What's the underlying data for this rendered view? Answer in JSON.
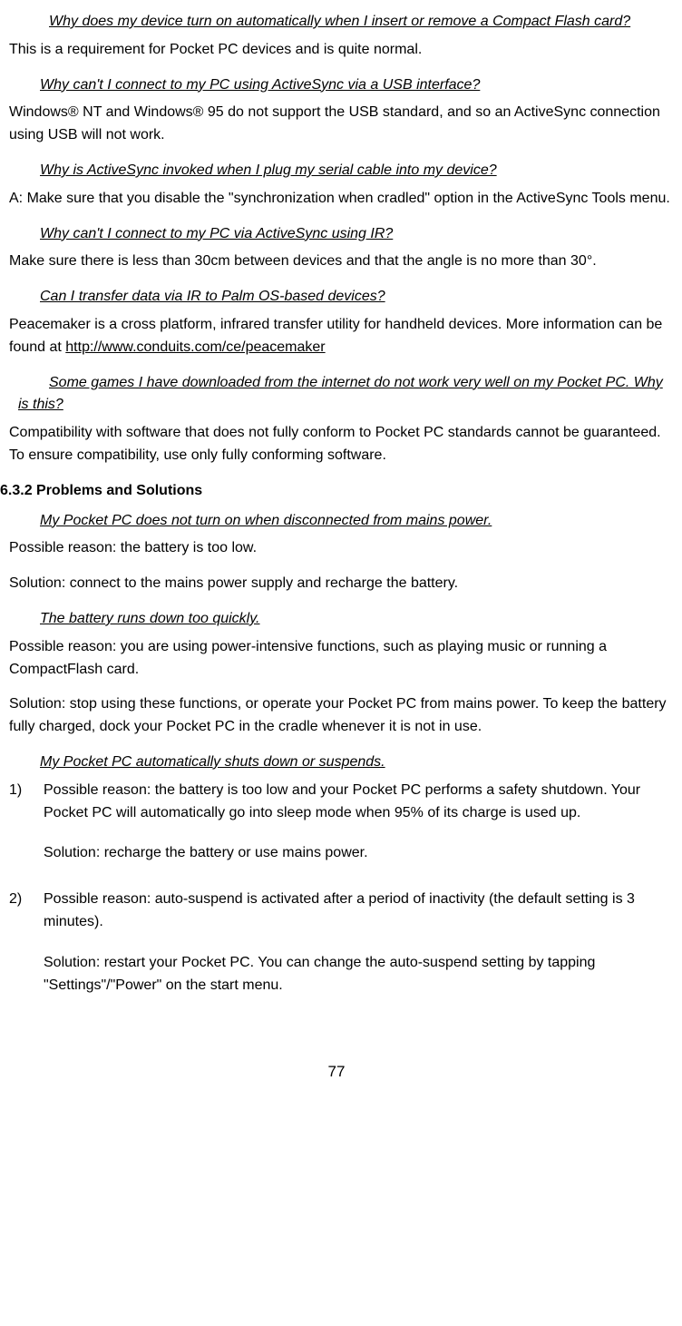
{
  "q1": "Why does my device turn on automatically when I insert or remove a Compact Flash card?",
  "a1": "This is a requirement for Pocket PC devices and is quite normal.",
  "q2": "Why can't I connect to my PC using ActiveSync via a USB interface?",
  "a2": "Windows® NT and Windows® 95 do not support the USB standard, and so an ActiveSync connection using USB will not work.",
  "q3": "Why is ActiveSync invoked when I plug my serial cable into my device?",
  "a3": "A: Make sure that you disable the \"synchronization when cradled\" option in the ActiveSync Tools menu.",
  "q4": "Why can't I connect to my PC via ActiveSync using IR?",
  "a4": "Make sure there is less than 30cm between devices and that the angle is no more than 30°.",
  "q5": "Can I transfer data via IR to Palm OS-based devices?",
  "a5_pre": "Peacemaker is a cross platform, infrared transfer utility for handheld devices. More information can be found at ",
  "a5_link": "http://www.conduits.com/ce/peacemaker",
  "q6": "Some games I have downloaded from the internet do not work very well on my Pocket PC. Why is this?",
  "a6": "Compatibility with software that does not fully conform to Pocket PC standards cannot be guaranteed. To ensure compatibility, use only fully conforming software.",
  "section": "6.3.2 Problems and Solutions",
  "q7": "My Pocket PC does not turn on when disconnected from mains power.",
  "a7a": "Possible reason: the battery is too low.",
  "a7b": "Solution: connect to the mains power supply and recharge the battery.",
  "q8": "The battery runs down too quickly.",
  "a8a": "Possible reason: you are using power-intensive functions, such as playing music or running a CompactFlash card.",
  "a8b": "Solution: stop using these functions, or operate your Pocket PC from mains power. To keep the battery fully charged, dock your Pocket PC in the cradle whenever it is not in use.",
  "q9": "My Pocket PC automatically shuts down or suspends.",
  "list1_num": "1)",
  "list1_a": "Possible reason: the battery is too low and your Pocket PC performs a safety shutdown. Your Pocket PC will automatically go into sleep mode when 95% of its charge is used up.",
  "list1_b": "Solution: recharge the battery or use mains power.",
  "list2_num": "2)",
  "list2_a": "Possible reason: auto-suspend is activated after a period of inactivity (the default setting is 3 minutes).",
  "list2_b": "Solution: restart your Pocket PC. You can change the auto-suspend setting by tapping \"Settings\"/\"Power\" on the start menu.",
  "page": "77"
}
